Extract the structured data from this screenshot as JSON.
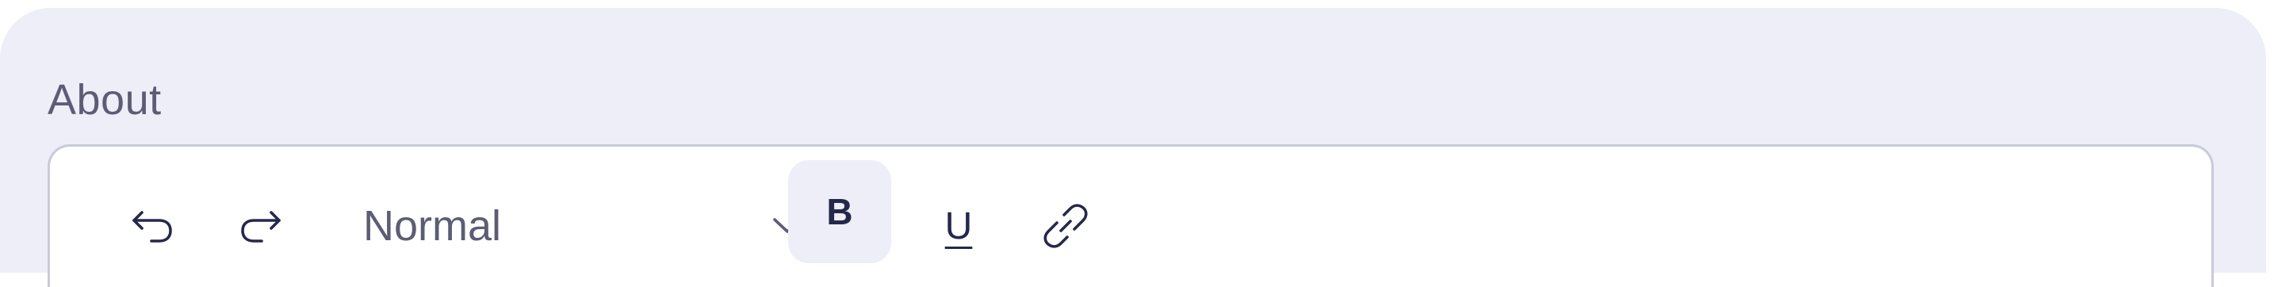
{
  "section": {
    "label": "About"
  },
  "toolbar": {
    "format_select_value": "Normal",
    "bold_label": "B",
    "underline_label": "U",
    "icons": {
      "undo": "undo-icon",
      "redo": "redo-icon",
      "chevron": "chevron-down-icon",
      "link": "link-icon"
    },
    "active_button": "bold"
  },
  "colors": {
    "panel_background": "#edeef7",
    "editor_background": "#ffffff",
    "editor_border": "#c9cad9",
    "text_muted": "#5c5d74",
    "text_dark": "#26284a",
    "active_button_background": "#edeef7"
  }
}
